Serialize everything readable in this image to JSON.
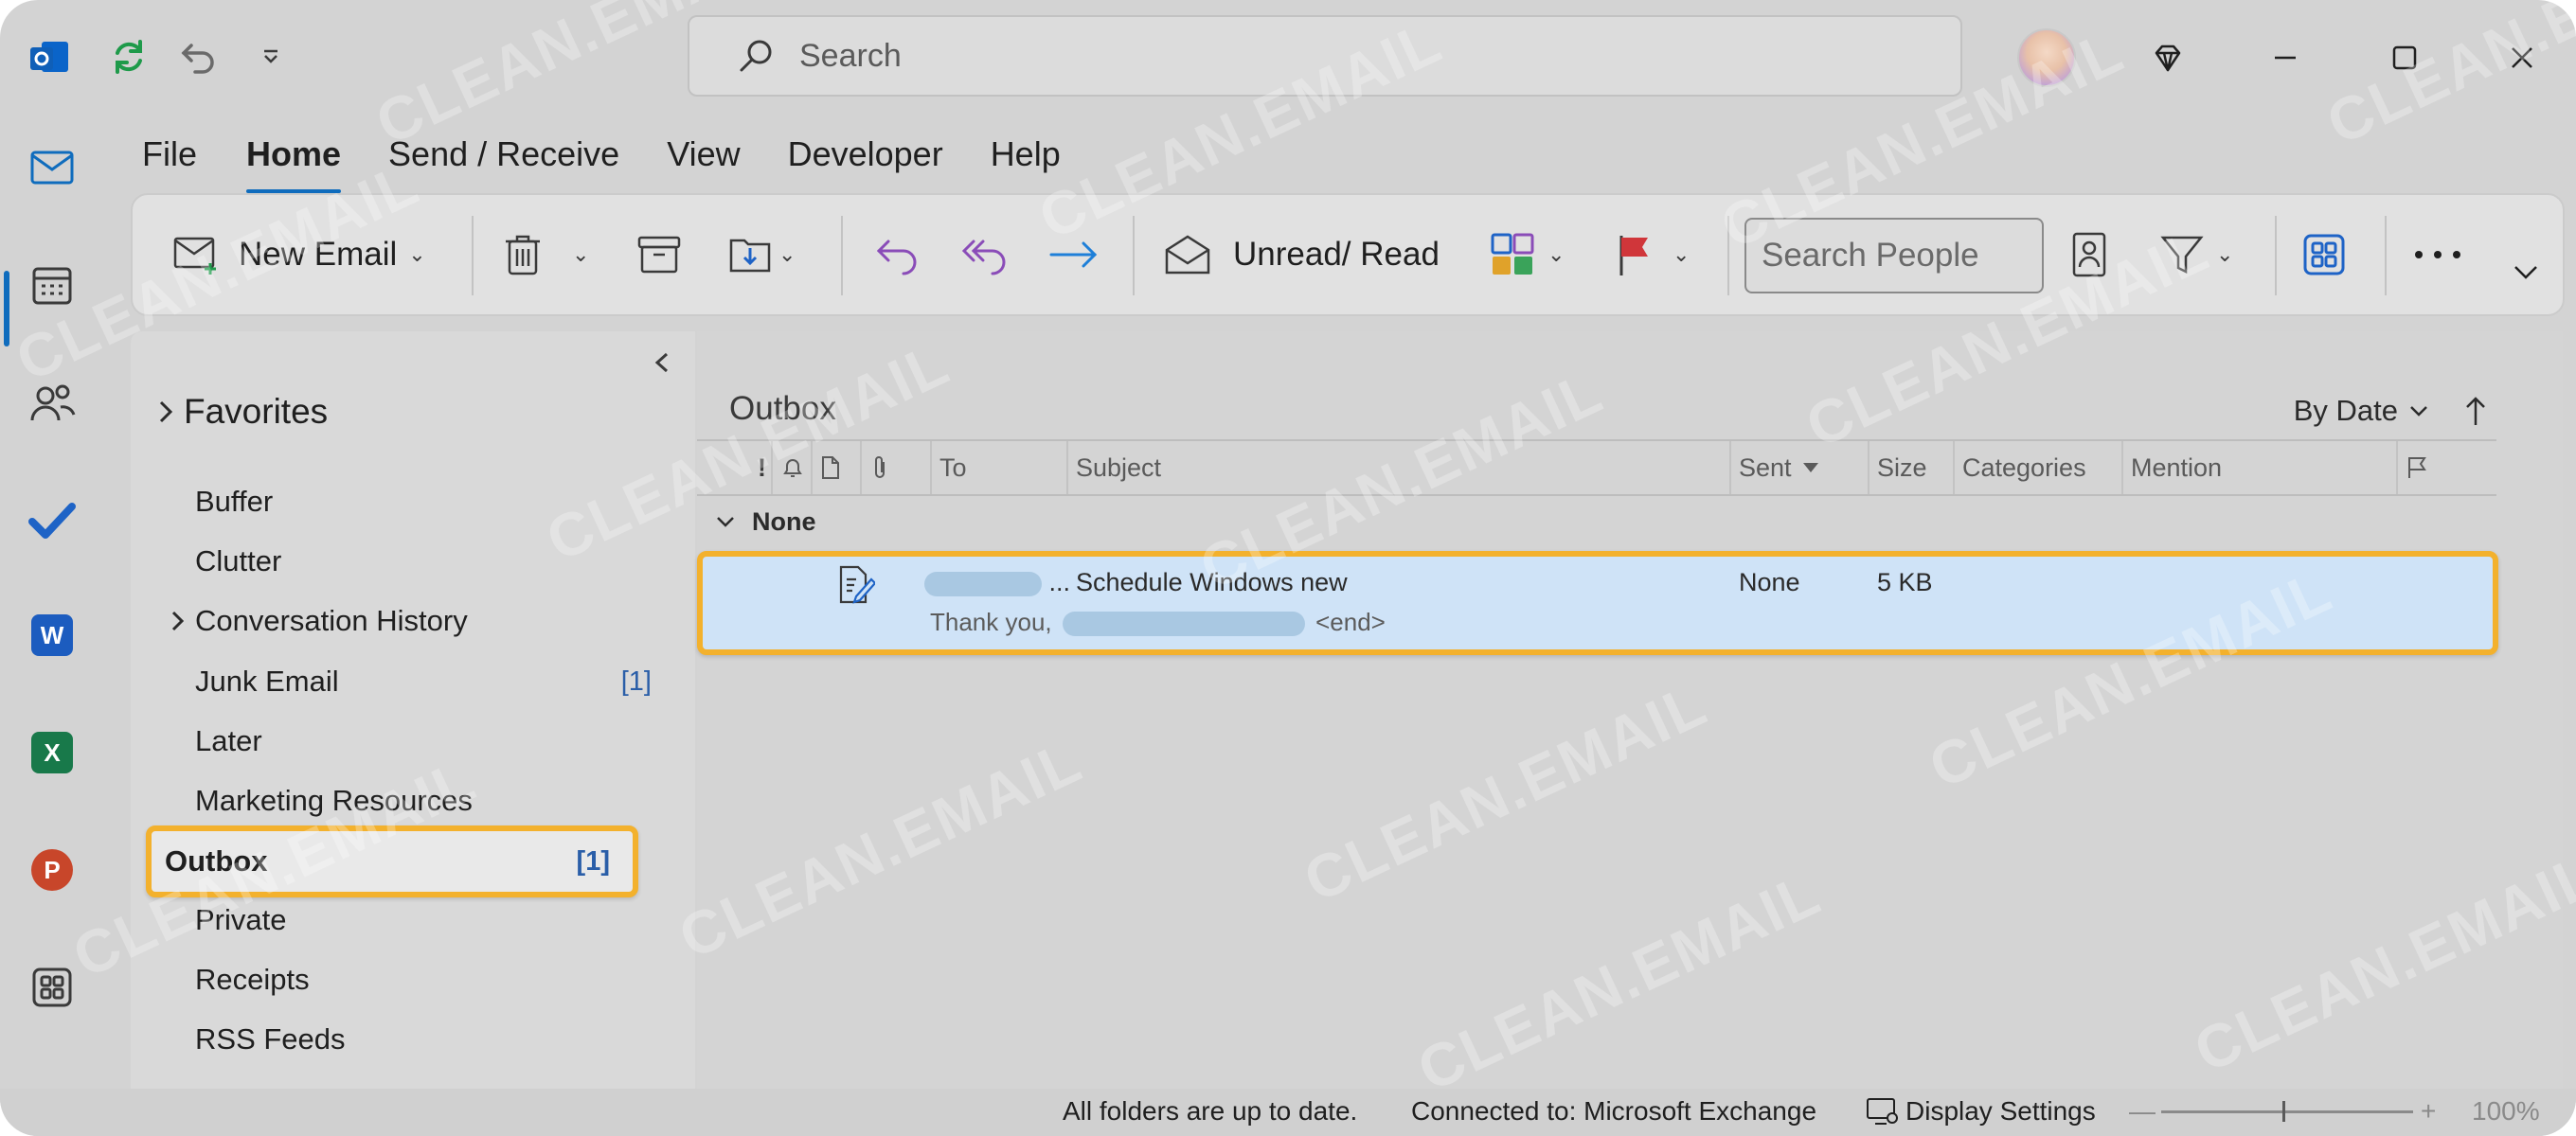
{
  "titlebar": {
    "search_placeholder": "Search",
    "app_icon": "outlook-logo-icon",
    "sync_icon": "sync-icon",
    "undo_icon": "undo-icon",
    "customize_icon": "customize-quick-access-icon",
    "premium_icon": "diamond-icon"
  },
  "menu": {
    "tabs": [
      {
        "label": "File"
      },
      {
        "label": "Home"
      },
      {
        "label": "Send / Receive"
      },
      {
        "label": "View"
      },
      {
        "label": "Developer"
      },
      {
        "label": "Help"
      }
    ],
    "active_tab": "Home"
  },
  "ribbon": {
    "new_email": "New Email",
    "unread_read": "Unread/ Read",
    "search_people_placeholder": "Search People"
  },
  "folders": {
    "favorites": "Favorites",
    "items": [
      {
        "label": "Buffer",
        "count": ""
      },
      {
        "label": "Clutter",
        "count": ""
      },
      {
        "label": "Conversation History",
        "count": ""
      },
      {
        "label": "Junk Email",
        "count": "[1]"
      },
      {
        "label": "Later",
        "count": ""
      },
      {
        "label": "Marketing Resources",
        "count": ""
      },
      {
        "label": "Outbox",
        "count": "[1]"
      },
      {
        "label": "Private",
        "count": ""
      },
      {
        "label": "Receipts",
        "count": ""
      },
      {
        "label": "RSS Feeds",
        "count": ""
      }
    ],
    "selected": "Outbox"
  },
  "list": {
    "title": "Outbox",
    "sort": "By Date",
    "columns": {
      "importance": "!",
      "to": "To",
      "subject": "Subject",
      "sent": "Sent",
      "size": "Size",
      "categories": "Categories",
      "mention": "Mention"
    },
    "group": "None",
    "message": {
      "to_suffix": "...",
      "subject": "Schedule Windows new",
      "sent": "None",
      "size": "5 KB",
      "preview_start": "Thank you,",
      "preview_end": "<end>"
    }
  },
  "status": {
    "sync": "All folders are up to date.",
    "connection": "Connected to: Microsoft Exchange",
    "display_settings": "Display Settings",
    "zoom": "100%"
  },
  "watermark": "CLEAN.EMAIL",
  "colors": {
    "accent": "#0f6cbd",
    "highlight": "#f3b12d",
    "selected_row": "#cfe3f7"
  }
}
